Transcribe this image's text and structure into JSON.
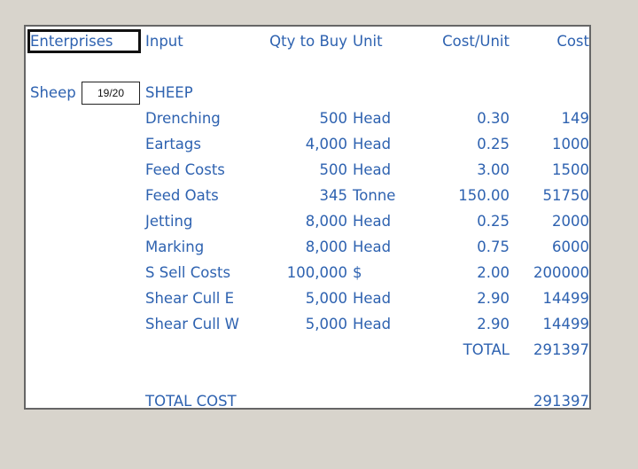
{
  "colors": {
    "text": "#2e62b0",
    "background": "#d8d4cc",
    "sheet": "#ffffff",
    "border": "#666666"
  },
  "header": {
    "enterprises": "Enterprises",
    "input": "Input",
    "qty": "Qty to Buy",
    "unit": "Unit",
    "cost_unit": "Cost/Unit",
    "cost": "Cost"
  },
  "enterprise": {
    "label": "Sheep",
    "pager": "19/20",
    "section": "SHEEP"
  },
  "rows": [
    {
      "input": "Drenching",
      "qty": "500",
      "unit": "Head",
      "cost_unit": "0.30",
      "cost": "149"
    },
    {
      "input": "Eartags",
      "qty": "4,000",
      "unit": "Head",
      "cost_unit": "0.25",
      "cost": "1000"
    },
    {
      "input": "Feed Costs",
      "qty": "500",
      "unit": "Head",
      "cost_unit": "3.00",
      "cost": "1500"
    },
    {
      "input": "Feed Oats",
      "qty": "345",
      "unit": "Tonne",
      "cost_unit": "150.00",
      "cost": "51750"
    },
    {
      "input": "Jetting",
      "qty": "8,000",
      "unit": "Head",
      "cost_unit": "0.25",
      "cost": "2000"
    },
    {
      "input": "Marking",
      "qty": "8,000",
      "unit": "Head",
      "cost_unit": "0.75",
      "cost": "6000"
    },
    {
      "input": "S Sell Costs",
      "qty": "100,000",
      "unit": "$",
      "cost_unit": "2.00",
      "cost": "200000"
    },
    {
      "input": "Shear Cull E",
      "qty": "5,000",
      "unit": "Head",
      "cost_unit": "2.90",
      "cost": "14499"
    },
    {
      "input": "Shear Cull W",
      "qty": "5,000",
      "unit": "Head",
      "cost_unit": "2.90",
      "cost": "14499"
    }
  ],
  "total": {
    "label": "TOTAL",
    "value": "291397"
  },
  "total_cost": {
    "label": "TOTAL COST",
    "value": "291397"
  }
}
